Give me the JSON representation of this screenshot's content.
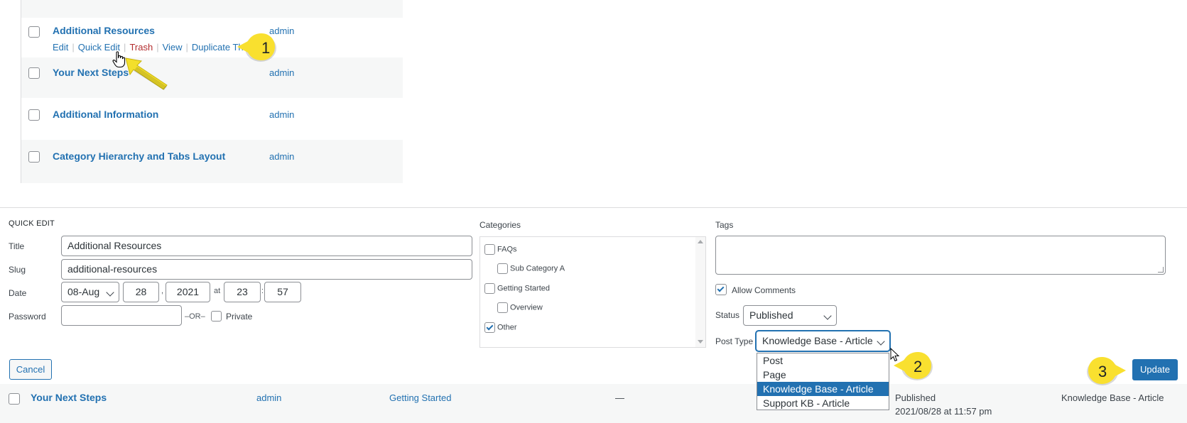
{
  "list": {
    "rows": [
      {
        "title": "Additional Resources",
        "author": "admin"
      },
      {
        "title": "Your Next Steps",
        "author": "admin"
      },
      {
        "title": "Additional Information",
        "author": "admin"
      },
      {
        "title": "Category Hierarchy and Tabs Layout",
        "author": "admin"
      }
    ],
    "row_actions": {
      "edit": "Edit",
      "quick_edit": "Quick Edit",
      "trash": "Trash",
      "view": "View",
      "duplicate": "Duplicate This",
      "separator": "|"
    }
  },
  "quick_edit": {
    "heading": "QUICK EDIT",
    "title_label": "Title",
    "title_value": "Additional Resources",
    "slug_label": "Slug",
    "slug_value": "additional-resources",
    "date_label": "Date",
    "date_month": "08-Aug",
    "date_day": "28",
    "date_year": "2021",
    "date_at": "at",
    "date_hour": "23",
    "date_minute": "57",
    "date_comma": ",",
    "date_colon": ":",
    "password_label": "Password",
    "password_value": "",
    "or_text": "–OR–",
    "private_label": "Private",
    "categories_label": "Categories",
    "categories": [
      {
        "name": "FAQs",
        "checked": false
      },
      {
        "name": "Sub Category A",
        "checked": false
      },
      {
        "name": "Getting Started",
        "checked": false
      },
      {
        "name": "Overview",
        "checked": false
      },
      {
        "name": "Other",
        "checked": true
      }
    ],
    "tags_label": "Tags",
    "tags_value": "",
    "allow_comments_label": "Allow Comments",
    "status_label": "Status",
    "status_value": "Published",
    "post_type_label": "Post Type",
    "post_type_value": "Knowledge Base - Article",
    "post_type_options": [
      "Post",
      "Page",
      "Knowledge Base - Article",
      "Support KB - Article"
    ],
    "cancel_label": "Cancel",
    "update_label": "Update"
  },
  "bottom_row": {
    "title": "Your Next Steps",
    "author": "admin",
    "category": "Getting Started",
    "tags": "—",
    "status": "Published",
    "datetime": "2021/08/28 at 11:57 pm",
    "post_type": "Knowledge Base - Article"
  },
  "callouts": [
    "1",
    "2",
    "3"
  ],
  "colors": {
    "link": "#2271b1",
    "trash": "#b32d2e",
    "callout": "#f9e02f",
    "arrow": "#f3df2b"
  },
  "icons": [
    "checkbox-icon",
    "chevron-down-icon",
    "hand-cursor-icon",
    "arrow-cursor-icon",
    "yellow-arrow-icon",
    "scroll-up-icon",
    "scroll-down-icon",
    "checkmark-icon"
  ]
}
